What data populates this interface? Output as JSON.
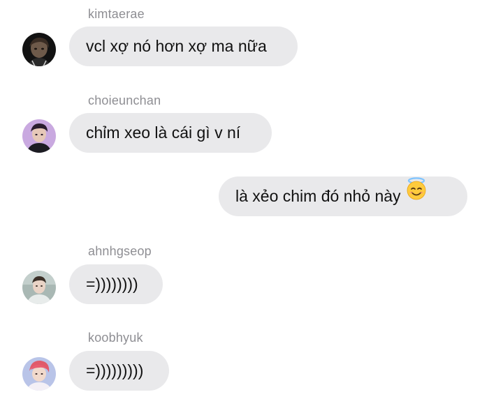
{
  "messages": [
    {
      "sender": "kimtaerae",
      "text": "vcl xợ nó hơn xợ ma nữa",
      "avatar": "avatar-kimtaerae"
    },
    {
      "sender": "choieunchan",
      "text": "chỉm xeo là cái gì v ní",
      "avatar": "avatar-choieunchan"
    },
    {
      "sender": "",
      "text": "là xẻo chim đó nhỏ này",
      "emoji": "smiling-face-with-halo-icon"
    },
    {
      "sender": "ahnhgseop",
      "text": "=))))))))",
      "avatar": "avatar-ahnhgseop"
    },
    {
      "sender": "koobhyuk",
      "text": "=)))))))))",
      "avatar": "avatar-koobhyuk"
    }
  ],
  "colors": {
    "bubble": "#e9e9eb",
    "sender_name": "#8e8e93",
    "message_text": "#111111",
    "background": "#ffffff"
  }
}
